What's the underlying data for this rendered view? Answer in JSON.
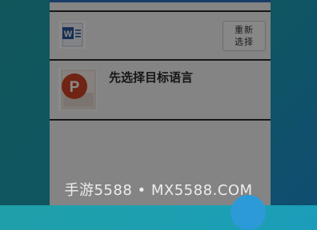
{
  "conversion": {
    "convert_button_label_line1": "重新",
    "convert_button_label_line2": "选择",
    "word_file_icon": "word-document-icon",
    "ppt_file_icon": "ppt-document-icon",
    "ppt_file_title": "先选择目标语言"
  },
  "watermark": {
    "text": "手游5588 • MX5588.COM"
  },
  "colors": {
    "accent_blue": "#2e6fbf",
    "word_blue": "#2b579a",
    "ppt_red": "#d04423",
    "fab_blue": "#2d9ad8"
  }
}
